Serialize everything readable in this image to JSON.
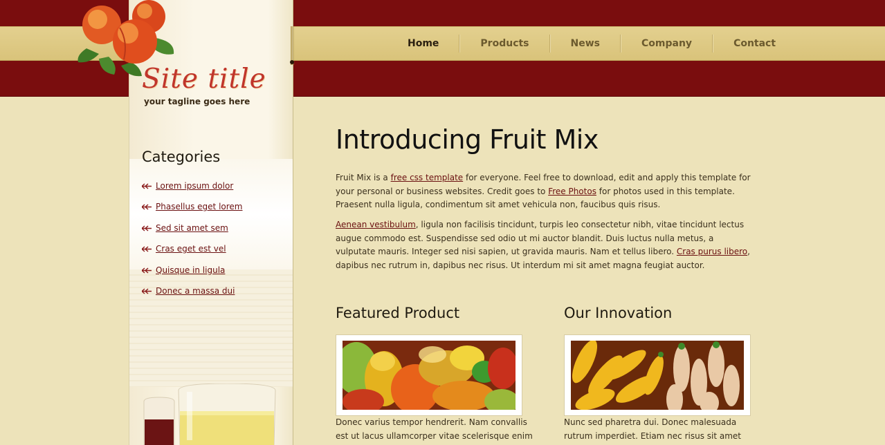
{
  "site": {
    "title": "Site title",
    "tagline": "your tagline goes here"
  },
  "nav": {
    "items": [
      "Home",
      "Products",
      "News",
      "Company",
      "Contact"
    ],
    "active": "Home"
  },
  "sidebar": {
    "categories_title": "Categories",
    "categories": [
      "Lorem ipsum dolor",
      "Phasellus eget lorem",
      "Sed sit amet sem",
      "Cras eget est vel",
      "Quisque in ligula",
      "Donec a massa dui"
    ]
  },
  "main": {
    "title": "Introducing Fruit Mix",
    "p1": {
      "a": "Fruit Mix is a ",
      "link1": "free css template",
      "b": " for everyone. Feel free to download, edit and apply this template for your personal or business websites. Credit goes to ",
      "link2": "Free Photos",
      "c": " for photos used in this template. Praesent nulla ligula, condimentum sit amet vehicula non, faucibus quis risus."
    },
    "p2": {
      "link1": "Aenean vestibulum",
      "a": ", ligula non facilisis tincidunt, turpis leo consectetur nibh, vitae tincidunt lectus augue commodo est. Suspendisse sed odio ut mi auctor blandit. Duis luctus nulla metus, a vulputate mauris. Integer sed nisi sapien, ut gravida mauris. Nam et tellus libero. ",
      "link2": "Cras purus libero",
      "b": ", dapibus nec rutrum in, dapibus nec risus. Ut interdum mi sit amet magna feugiat auctor."
    },
    "featured": {
      "title": "Featured Product",
      "text": "Donec varius tempor hendrerit. Nam convallis est ut lacus ullamcorper vitae scelerisque enim"
    },
    "innovation": {
      "title": "Our Innovation",
      "text": "Nunc sed pharetra dui. Donec malesuada rutrum imperdiet. Etiam nec risus sit amet"
    }
  },
  "colors": {
    "header_red": "#7a0d0e",
    "nav_gold": "#ddc87f",
    "page_bg": "#ede3ba",
    "title_red": "#c0352b",
    "link": "#6a1010"
  }
}
